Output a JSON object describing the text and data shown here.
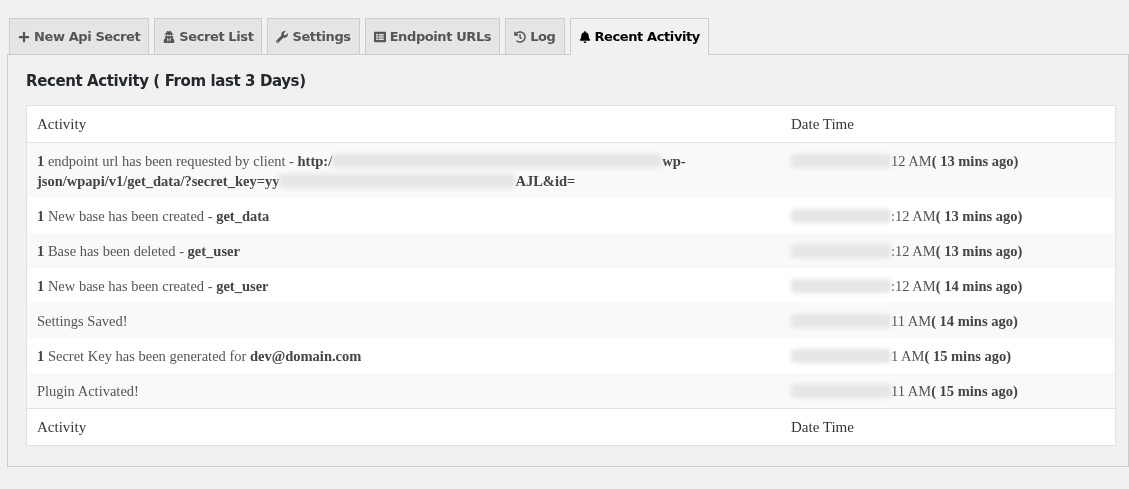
{
  "tabs": [
    {
      "label": "New Api Secret",
      "kind": "plus",
      "selected": false
    },
    {
      "label": "Secret List",
      "kind": "secret",
      "selected": false
    },
    {
      "label": "Settings",
      "kind": "wrench",
      "selected": false
    },
    {
      "label": "Endpoint URLs",
      "kind": "list",
      "selected": false
    },
    {
      "label": "Log",
      "kind": "history",
      "selected": false
    },
    {
      "label": "Recent Activity",
      "kind": "bell",
      "selected": true
    }
  ],
  "panel": {
    "title": "Recent Activity ( From last 3 Days)",
    "table": {
      "columns": [
        "Activity",
        "Date Time"
      ],
      "rows": [
        {
          "activity": [
            [
              {
                "kind": "text",
                "text": "**1** endpoint url has been requested by client - **http:/**"
              },
              {
                "kind": "blur_wide"
              },
              {
                "kind": "text",
                "text": "**wp-**"
              }
            ],
            [
              {
                "kind": "text",
                "text": "**json/wpapi/v1/get_data/?secret_key=yy**"
              },
              {
                "kind": "blur_narrow"
              },
              {
                "kind": "text",
                "text": "**AJL&id=**"
              }
            ]
          ],
          "time": "12 AM",
          "ago": "( 13 mins ago)"
        },
        {
          "activity": [
            [
              {
                "kind": "text",
                "text": "**1** New base has been created - **get_data**"
              }
            ]
          ],
          "time": ":12 AM",
          "ago": "( 13 mins ago)"
        },
        {
          "activity": [
            [
              {
                "kind": "text",
                "text": "**1** Base has been deleted - **get_user**"
              }
            ]
          ],
          "time": ":12 AM",
          "ago": "( 13 mins ago)"
        },
        {
          "activity": [
            [
              {
                "kind": "text",
                "text": "**1** New base has been created - **get_user**"
              }
            ]
          ],
          "time": ":12 AM",
          "ago": "( 14 mins ago)"
        },
        {
          "activity": [
            [
              {
                "kind": "text",
                "text": "Settings Saved!"
              }
            ]
          ],
          "time": "11 AM",
          "ago": "( 14 mins ago)"
        },
        {
          "activity": [
            [
              {
                "kind": "text",
                "text": "**1** Secret Key has been generated for **dev@domain.com**"
              }
            ]
          ],
          "time": "1 AM",
          "ago": "( 15 mins ago)"
        },
        {
          "activity": [
            [
              {
                "kind": "text",
                "text": "Plugin Activated!"
              }
            ]
          ],
          "time": "11 AM",
          "ago": "( 15 mins ago)"
        }
      ],
      "footer": [
        "Activity",
        "Date Time"
      ]
    }
  }
}
